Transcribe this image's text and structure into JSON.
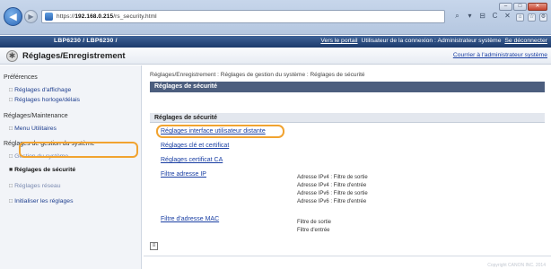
{
  "browser": {
    "url_prefix": "https://",
    "url_host": "192.168.0.215",
    "url_path": "/rs_security.html",
    "tools": [
      "⌕",
      "▾",
      "⊟",
      "C",
      "✕"
    ],
    "tab_icons": [
      "⌂",
      "☆",
      "⚙"
    ],
    "window_buttons": [
      "–",
      "□",
      "✕"
    ]
  },
  "printer_bar": {
    "model": "LBP6230 / LBP6230 /",
    "portal_link": "Vers le portail",
    "user_label": "Utilisateur de la connexion : Administrateur système",
    "logout_link": "Se déconnecter"
  },
  "title_bar": {
    "title": "Réglages/Enregistrement",
    "return_link": "Courrier à l'administrateur système"
  },
  "sidebar": {
    "sections": [
      {
        "label": "Préférences",
        "items": [
          {
            "label": "Réglages d'affichage"
          },
          {
            "label": "Réglages horloge/délais"
          }
        ]
      },
      {
        "label": "Réglages/Maintenance",
        "items": [
          {
            "label": "Menu Utilitaires"
          }
        ]
      },
      {
        "label": "Réglages de gestion du système",
        "items": [
          {
            "label": "Gestion du système"
          },
          {
            "label": "Réglages de sécurité",
            "active": true
          },
          {
            "label": "Réglages réseau"
          },
          {
            "label": "Initialiser les réglages"
          }
        ]
      }
    ]
  },
  "main": {
    "breadcrumb": "Réglages/Enregistrement : Réglages de gestion du système : Réglages de sécurité",
    "page_title": "Réglages de sécurité",
    "section_title": "Réglages de sécurité",
    "links": [
      {
        "label": "Réglages interface utilisateur distante"
      },
      {
        "label": "Réglages clé et certificat"
      },
      {
        "label": "Réglages certificat CA"
      },
      {
        "label": "Filtre adresse IP"
      },
      {
        "label": "Filtre d'adresse MAC"
      }
    ],
    "ip_filter_info": [
      "Adresse IPv4 : Filtre de sortie",
      "Adresse IPv4 : Filtre d'entrée",
      "Adresse IPv6 : Filtre de sortie",
      "Adresse IPv6 : Filtre d'entrée"
    ],
    "mac_filter_info": [
      "Filtre de sortie",
      "Filtre d'entrée"
    ],
    "copyright": "Copyright CANON INC. 2014"
  },
  "colors": {
    "header_bar": "#1c3a6b",
    "page_head": "#4c5e7e",
    "highlight": "#f1a330",
    "link": "#1a3fa3"
  }
}
